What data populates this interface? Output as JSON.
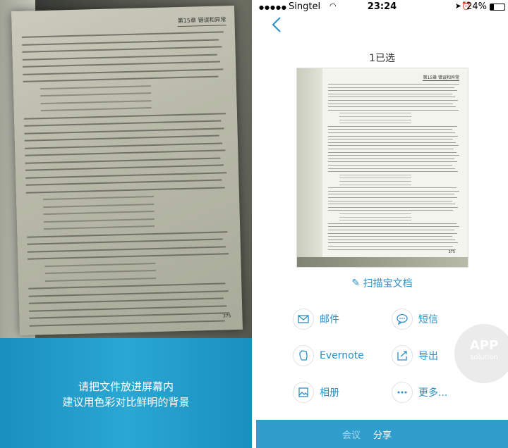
{
  "left": {
    "page_header": "第15章  错误和异常",
    "page_number": "375",
    "instructions": [
      "请把文件放进屏幕内",
      "建议用色彩对比鲜明的背景"
    ]
  },
  "right": {
    "status": {
      "carrier": "Singtel",
      "time": "23:24",
      "battery": "24%"
    },
    "selected_count": "1已选",
    "thumbnail": {
      "header": "第15章  错误和异常",
      "page_number": "375"
    },
    "scan_link": "扫描宝文档",
    "share_items": [
      {
        "label": "邮件",
        "icon": "mail-icon"
      },
      {
        "label": "短信",
        "icon": "message-icon"
      },
      {
        "label": "Evernote",
        "icon": "evernote-icon"
      },
      {
        "label": "导出",
        "icon": "export-icon"
      },
      {
        "label": "相册",
        "icon": "photos-icon"
      },
      {
        "label": "更多...",
        "icon": "more-icon"
      }
    ],
    "watermark": {
      "line1": "APP",
      "line2": "solution"
    },
    "tabs": [
      {
        "label": "会议",
        "active": false
      },
      {
        "label": "分享",
        "active": true
      }
    ],
    "colors": {
      "accent": "#2a8fc5",
      "tabbar": "#2f9ecd",
      "overlay": "#2aa7d3"
    }
  }
}
